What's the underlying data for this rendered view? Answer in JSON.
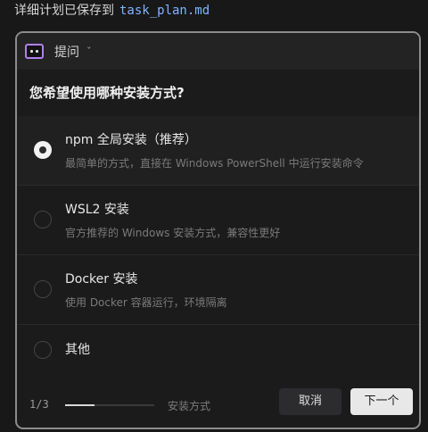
{
  "status_line": {
    "prefix": "详细计划已保存到",
    "filename": "task_plan.md"
  },
  "panel": {
    "header": {
      "icon": "chat-bubble-icon",
      "title": "提问",
      "chevron": "ˇ"
    },
    "question": "您希望使用哪种安装方式?",
    "options": [
      {
        "label": "npm 全局安装（推荐）",
        "description": "最简单的方式，直接在 Windows PowerShell 中运行安装命令",
        "selected": true
      },
      {
        "label": "WSL2 安装",
        "description": "官方推荐的 Windows 安装方式，兼容性更好",
        "selected": false
      },
      {
        "label": "Docker 安装",
        "description": "使用 Docker 容器运行，环境隔离",
        "selected": false
      },
      {
        "label": "其他",
        "description": "",
        "selected": false
      }
    ],
    "footer": {
      "step": "1/3",
      "progress_fraction": 0.333,
      "step_name": "安装方式",
      "cancel_label": "取消",
      "next_label": "下一个"
    }
  },
  "colors": {
    "background": "#181818",
    "accent": "#b07ff0",
    "filename": "#7fb4ff"
  }
}
